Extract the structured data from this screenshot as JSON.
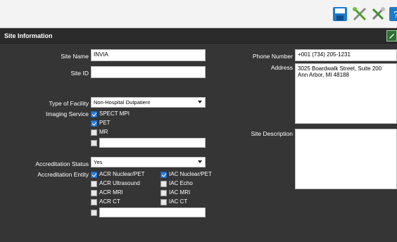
{
  "section": {
    "title": "Site Information"
  },
  "toolbar": {
    "icons": [
      "save-icon",
      "tools-icon",
      "settings-tools-icon",
      "help-icon"
    ]
  },
  "form": {
    "site_name": {
      "label": "Site Name",
      "value": "INVIA"
    },
    "site_id": {
      "label": "Site ID",
      "value": ""
    },
    "facility": {
      "label": "Type of Facility",
      "value": "Non-Hospital Outpatient"
    },
    "imaging": {
      "label": "Imaging Service",
      "options": [
        {
          "label": "SPECT MPI",
          "checked": true
        },
        {
          "label": "PET",
          "checked": true
        },
        {
          "label": "MR",
          "checked": false
        }
      ],
      "other_value": ""
    },
    "accreditation_status": {
      "label": "Accreditation Status",
      "value": "Yes"
    },
    "accreditation_entity": {
      "label": "Accreditation Entity",
      "left": [
        {
          "label": "ACR Nuclear/PET",
          "checked": true
        },
        {
          "label": "ACR Ultrasound",
          "checked": false
        },
        {
          "label": "ACR MRI",
          "checked": false
        },
        {
          "label": "ACR CT",
          "checked": false
        }
      ],
      "right": [
        {
          "label": "IAC Nuclear/PET",
          "checked": true
        },
        {
          "label": "IAC Echo",
          "checked": false
        },
        {
          "label": "IAC MRI",
          "checked": false
        },
        {
          "label": "IAC CT",
          "checked": false
        }
      ],
      "other_value": ""
    },
    "phone": {
      "label": "Phone Number",
      "value": "+001 (734) 205-1231"
    },
    "address": {
      "label": "Address",
      "value": "3025 Boardwalk Street, Suite 200\nAnn Arbor, MI 48188"
    },
    "site_description": {
      "label": "Site Description",
      "value": ""
    }
  }
}
